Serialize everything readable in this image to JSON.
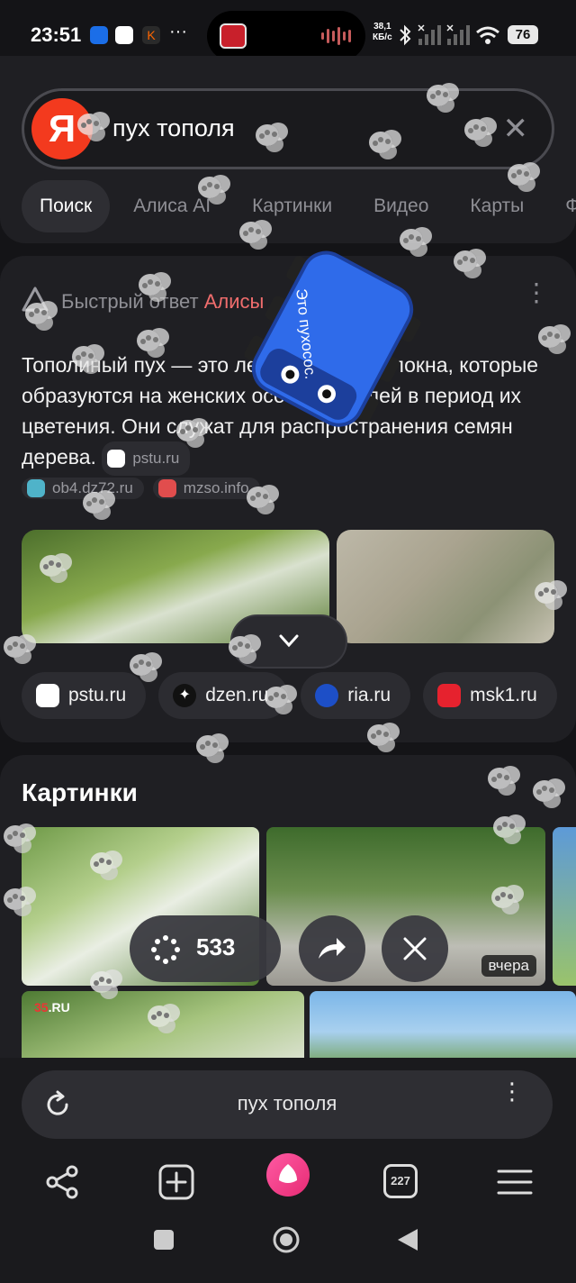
{
  "status_bar": {
    "time": "23:51",
    "more": "···",
    "speed_value": "38,1",
    "speed_unit": "КБ/с",
    "battery": "76"
  },
  "search": {
    "logo_letter": "Я",
    "query": "пух тополя",
    "clear_icon": "close-icon",
    "tabs": [
      "Поиск",
      "Алиса AI",
      "Картинки",
      "Видео",
      "Карты",
      "Ф"
    ]
  },
  "answer": {
    "header_prefix": "Быстрый ответ",
    "header_alice": "Алисы",
    "text": "Тополиный пух — это лёгкие белые волокна, которые образуются на женских особях тополей в период их цветения. Они служат для распространения семян дерева.",
    "inline_source": "pstu.ru",
    "sources": [
      "ob4.dz72.ru",
      "mzso.info"
    ],
    "site_chips": [
      {
        "label": "pstu.ru",
        "color": "#ffffff"
      },
      {
        "label": "dzen.ru",
        "color": "#111111"
      },
      {
        "label": "ria.ru",
        "color": "#1d4fc7"
      },
      {
        "label": "msk1.ru",
        "color": "#e6222e"
      }
    ]
  },
  "overlay": {
    "robot_caption": "Это пухосос.",
    "counter": "533"
  },
  "images": {
    "title": "Картинки",
    "badge": "вчера",
    "watermark_num": "35",
    "watermark_suffix": ".RU"
  },
  "bottom": {
    "url": "пух тополя",
    "tab_count": "227"
  },
  "colors": {
    "background": "#141417",
    "card": "#1f1f23",
    "yandex_red": "#f33a1e",
    "alice_pink": "#e72b74",
    "robot_blue": "#2f6bea"
  }
}
